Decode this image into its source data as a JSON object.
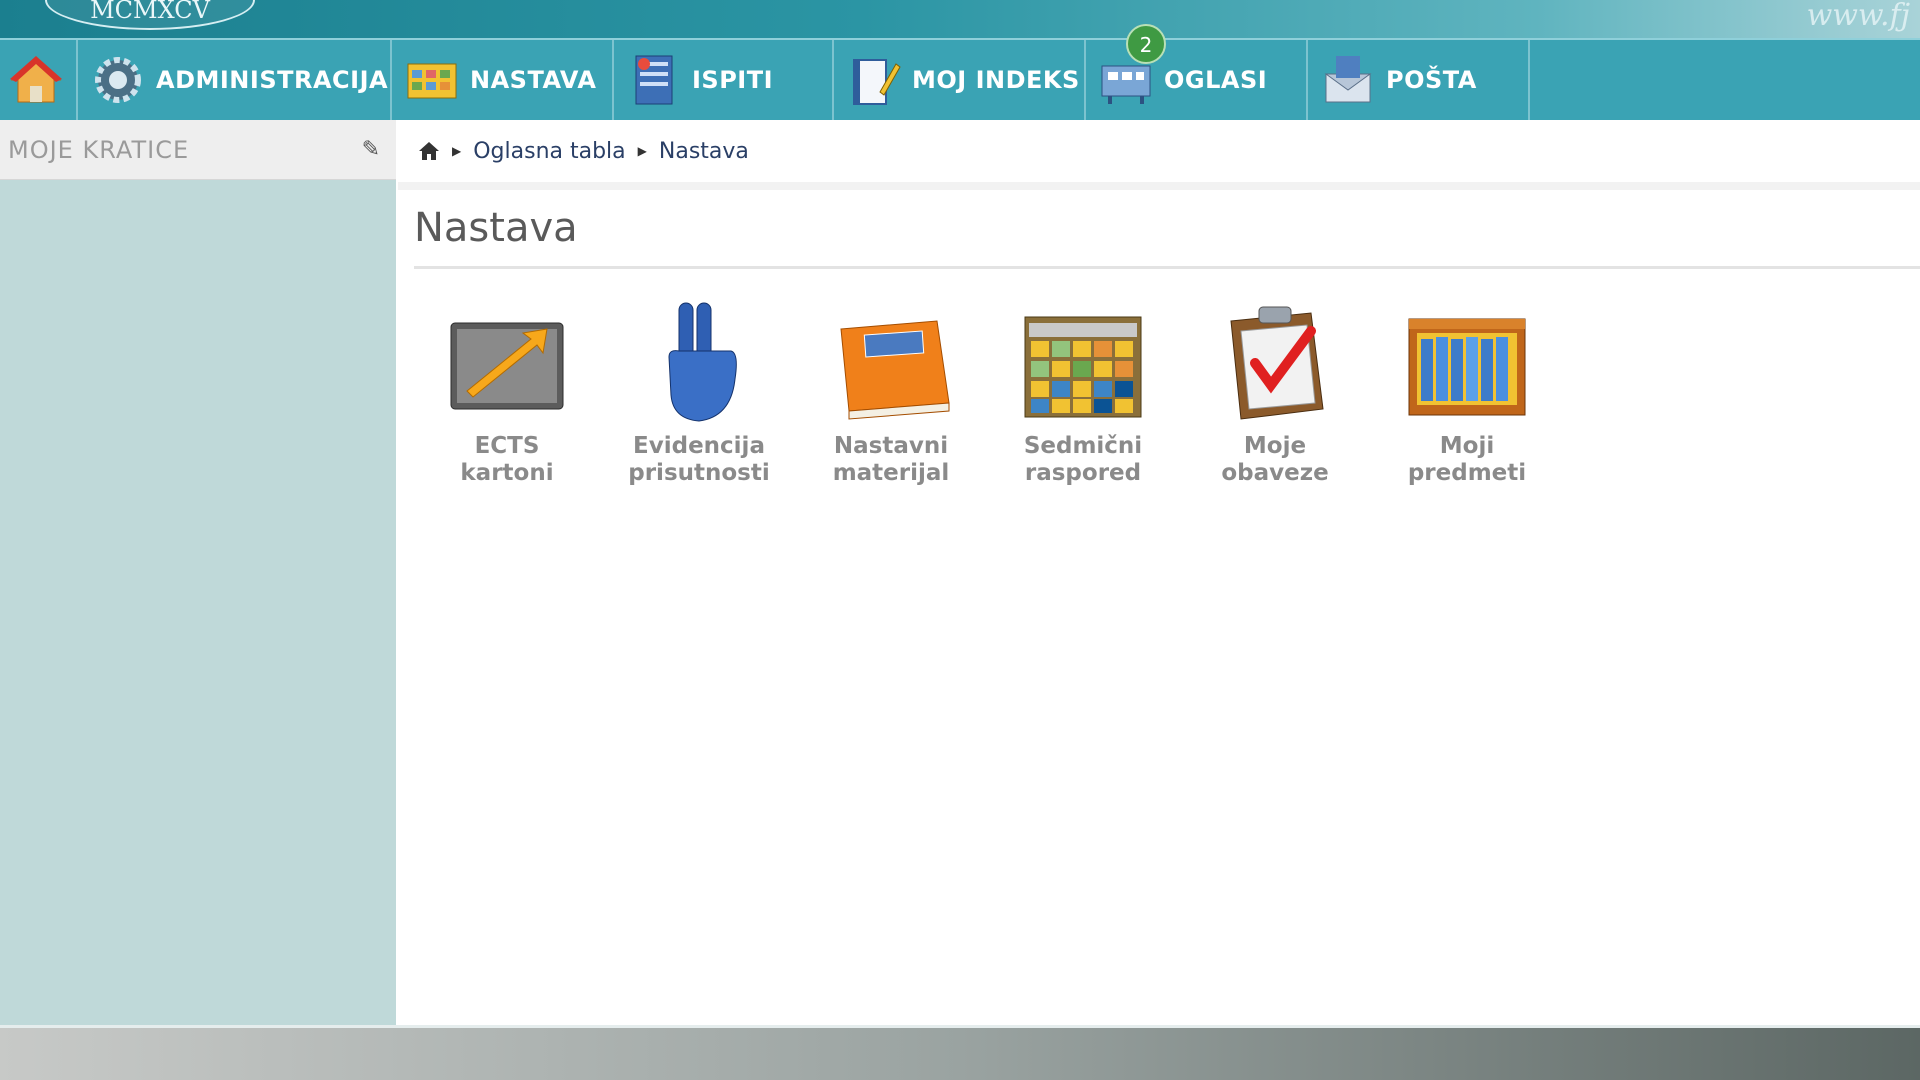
{
  "banner": {
    "seal_text": "MCMXCV",
    "site_text": "www.fj"
  },
  "nav": {
    "items": [
      {
        "label": ""
      },
      {
        "label": "ADMINISTRACIJA"
      },
      {
        "label": "NASTAVA"
      },
      {
        "label": "ISPITI"
      },
      {
        "label": "MOJ INDEKS"
      },
      {
        "label": "OGLASI",
        "badge": "2"
      },
      {
        "label": "POŠTA"
      }
    ]
  },
  "sidebar": {
    "title": "MOJE KRATICE"
  },
  "breadcrumb": {
    "items": [
      "Oglasna tabla",
      "Nastava"
    ]
  },
  "page": {
    "title": "Nastava"
  },
  "tiles": [
    {
      "line1": "ECTS",
      "line2": "kartoni",
      "icon": "ects-cards-icon"
    },
    {
      "line1": "Evidencija",
      "line2": "prisutnosti",
      "icon": "attendance-hand-icon"
    },
    {
      "line1": "Nastavni",
      "line2": "materijal",
      "icon": "book-icon"
    },
    {
      "line1": "Sedmični",
      "line2": "raspored",
      "icon": "schedule-icon"
    },
    {
      "line1": "Moje",
      "line2": "obaveze",
      "icon": "clipboard-check-icon"
    },
    {
      "line1": "Moji",
      "line2": "predmeti",
      "icon": "bookshelf-icon"
    }
  ],
  "colors": {
    "nav_bg": "#3aa3b4",
    "sidebar_bg": "#bfd9d9",
    "badge": "#3f9a43"
  }
}
